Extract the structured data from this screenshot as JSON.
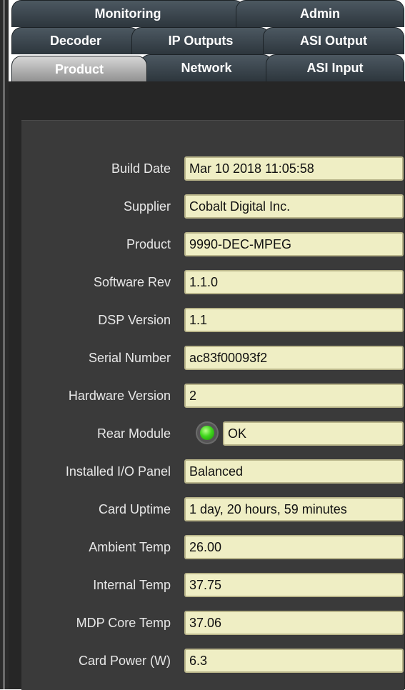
{
  "tabs": {
    "row1": [
      {
        "label": "Monitoring",
        "active": false
      },
      {
        "label": "Admin",
        "active": false
      }
    ],
    "row2": [
      {
        "label": "Decoder",
        "active": false
      },
      {
        "label": "IP Outputs",
        "active": false
      },
      {
        "label": "ASI Output",
        "active": false
      }
    ],
    "row3": [
      {
        "label": "Product",
        "active": true
      },
      {
        "label": "Network",
        "active": false
      },
      {
        "label": "ASI Input",
        "active": false
      }
    ]
  },
  "fields": [
    {
      "label": "Build Date",
      "value": "Mar 10 2018 11:05:58"
    },
    {
      "label": "Supplier",
      "value": "Cobalt Digital Inc."
    },
    {
      "label": "Product",
      "value": "9990-DEC-MPEG"
    },
    {
      "label": "Software Rev",
      "value": "1.1.0"
    },
    {
      "label": "DSP Version",
      "value": "1.1"
    },
    {
      "label": "Serial Number",
      "value": "ac83f00093f2"
    },
    {
      "label": "Hardware Version",
      "value": "2"
    },
    {
      "label": "Rear Module",
      "value": "OK",
      "led": "green"
    },
    {
      "label": "Installed I/O Panel",
      "value": "Balanced"
    },
    {
      "label": "Card Uptime",
      "value": "1 day, 20 hours, 59 minutes"
    },
    {
      "label": "Ambient Temp",
      "value": "26.00"
    },
    {
      "label": "Internal Temp",
      "value": "37.75"
    },
    {
      "label": "MDP Core Temp",
      "value": "37.06"
    },
    {
      "label": "Card Power (W)",
      "value": "6.3"
    }
  ],
  "colors": {
    "tab_dark": "#2d363d",
    "tab_active": "#a8a8a8",
    "panel_bg": "#3a3a3a",
    "field_bg": "#efeec4",
    "field_border": "#b9b58a",
    "led_green": "#3fd61c"
  }
}
